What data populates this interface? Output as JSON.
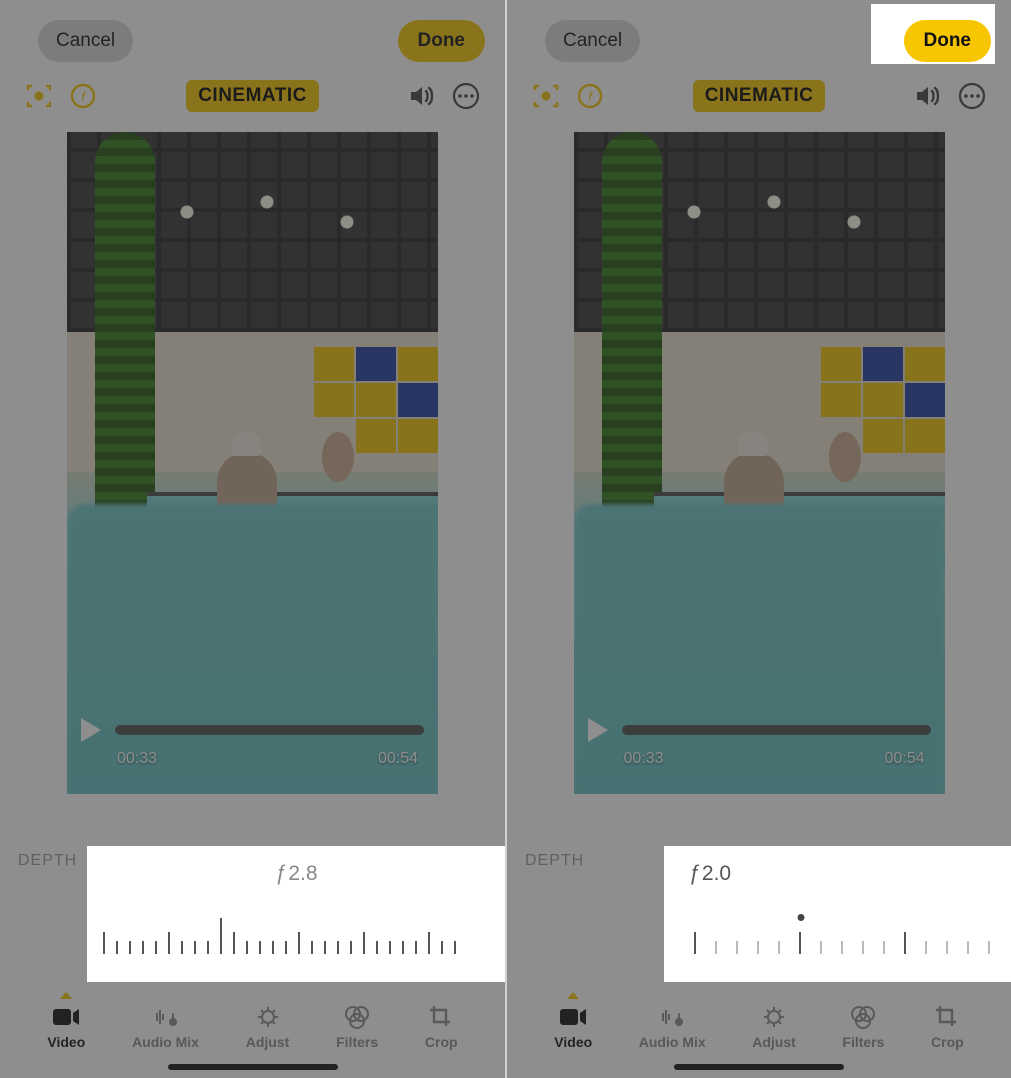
{
  "colors": {
    "accent": "#f7c600",
    "tab_active_dot": "#f7c600"
  },
  "panes": {
    "left": {
      "cancel_label": "Cancel",
      "done_label": "Done",
      "mode_badge": "CINEMATIC",
      "time_current": "00:33",
      "time_total": "00:54",
      "depth_label": "DEPTH",
      "fstop_symbol": "ƒ",
      "fstop_value": "2.8",
      "depth_show_dot": false,
      "done_highlighted": false
    },
    "right": {
      "cancel_label": "Cancel",
      "done_label": "Done",
      "mode_badge": "CINEMATIC",
      "time_current": "00:33",
      "time_total": "00:54",
      "depth_label": "DEPTH",
      "fstop_symbol": "ƒ",
      "fstop_value": "2.0",
      "depth_show_dot": true,
      "done_highlighted": true
    }
  },
  "tabs": [
    {
      "id": "video",
      "label": "Video",
      "active": true
    },
    {
      "id": "audiomix",
      "label": "Audio Mix",
      "active": false
    },
    {
      "id": "adjust",
      "label": "Adjust",
      "active": false
    },
    {
      "id": "filters",
      "label": "Filters",
      "active": false
    },
    {
      "id": "crop",
      "label": "Crop",
      "active": false
    }
  ],
  "ticks_small": 2,
  "ticks_major_every": 5
}
